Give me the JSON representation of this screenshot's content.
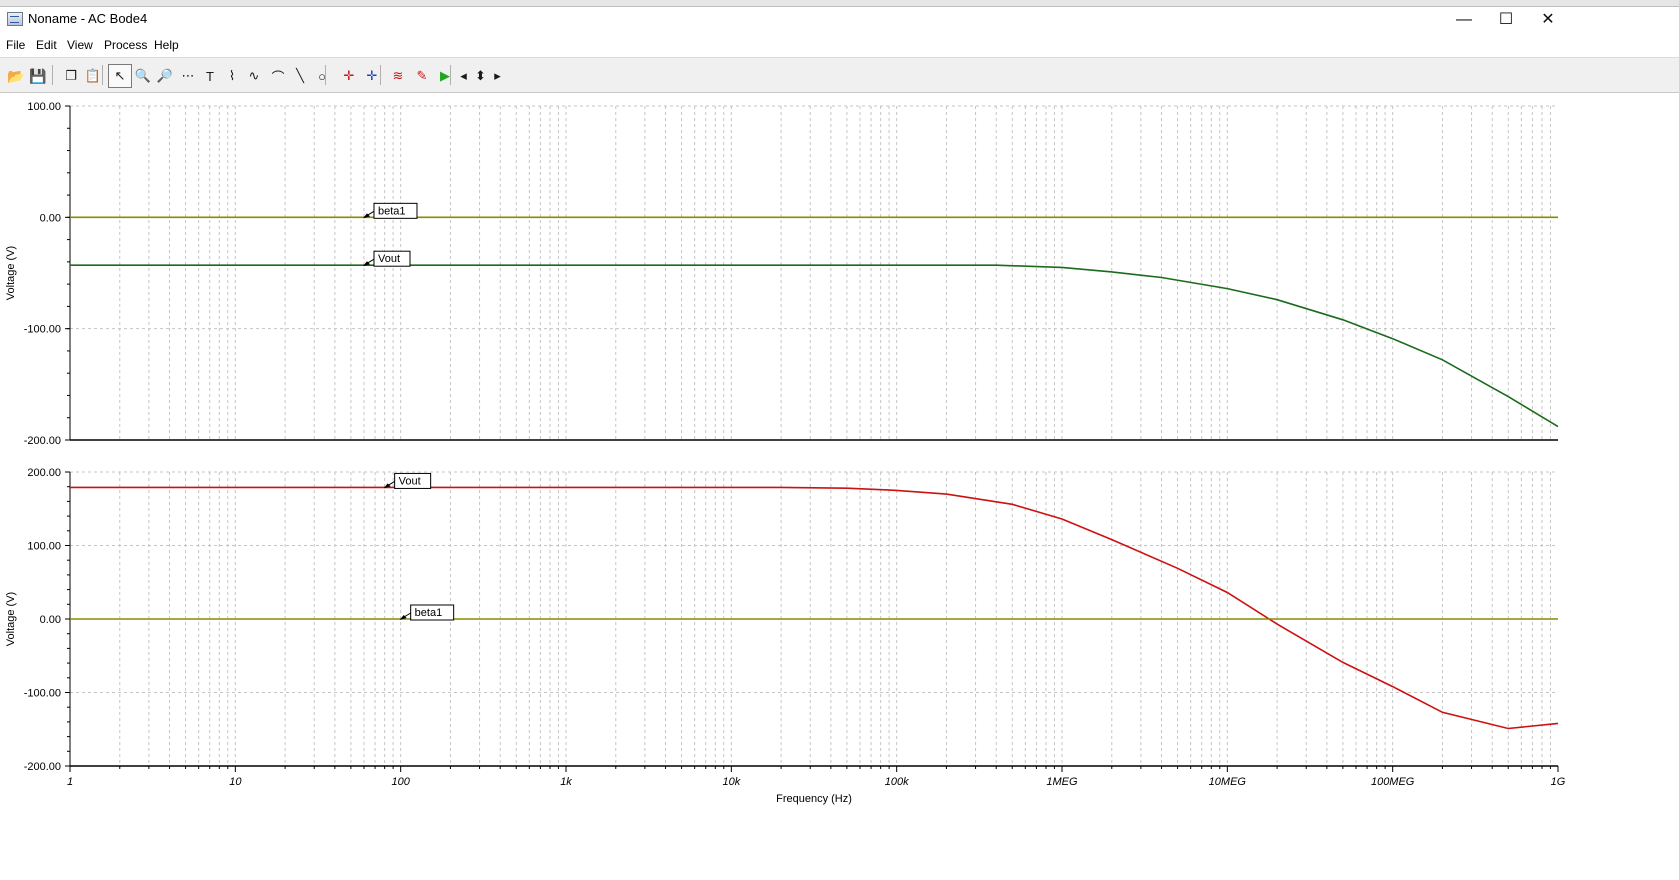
{
  "window": {
    "title": "Noname - AC Bode4",
    "minimize_glyph": "—",
    "maximize_glyph": "☐",
    "close_glyph": "✕"
  },
  "menu": [
    "File",
    "Edit",
    "View",
    "Process",
    "Help"
  ],
  "toolbar": [
    {
      "name": "open-file-button",
      "icon": "folder-open-icon",
      "glyph": "📂"
    },
    {
      "name": "save-button",
      "icon": "save-icon",
      "glyph": "💾"
    },
    {
      "name": "copy-button",
      "icon": "copy-icon",
      "glyph": "❐"
    },
    {
      "name": "paste-button",
      "icon": "paste-icon",
      "glyph": "📋"
    },
    {
      "name": "select-button",
      "icon": "cursor-arrow-icon",
      "glyph": "↖"
    },
    {
      "name": "zoom-in-button",
      "icon": "zoom-in-icon",
      "glyph": "🔍"
    },
    {
      "name": "zoom-out-button",
      "icon": "zoom-out-icon",
      "glyph": "🔎"
    },
    {
      "name": "grid-button",
      "icon": "grid-icon",
      "glyph": "⋯"
    },
    {
      "name": "text-button",
      "icon": "text-icon",
      "glyph": "T"
    },
    {
      "name": "label-button",
      "icon": "label-icon",
      "glyph": "⌇"
    },
    {
      "name": "curve-label-button",
      "icon": "curve-label-icon",
      "glyph": "∿"
    },
    {
      "name": "tangent-button",
      "icon": "tangent-icon",
      "glyph": "⌒"
    },
    {
      "name": "line-button",
      "icon": "line-icon",
      "glyph": "╲"
    },
    {
      "name": "circle-button",
      "icon": "circle-icon",
      "glyph": "○"
    },
    {
      "name": "cursor-a-button",
      "icon": "cursor-a-icon",
      "glyph": "✛"
    },
    {
      "name": "cursor-b-button",
      "icon": "cursor-b-icon",
      "glyph": "✛"
    },
    {
      "name": "add-curve-button",
      "icon": "add-curve-icon",
      "glyph": "≋"
    },
    {
      "name": "probe-button",
      "icon": "probe-icon",
      "glyph": "✎"
    },
    {
      "name": "run-button",
      "icon": "play-icon",
      "glyph": "▶"
    },
    {
      "name": "scroll-left-button",
      "icon": "arrow-left-icon",
      "glyph": "◂"
    },
    {
      "name": "scroll-updown-button",
      "icon": "arrow-updown-icon",
      "glyph": "⬍"
    },
    {
      "name": "scroll-right-button",
      "icon": "arrow-right-icon",
      "glyph": "▸"
    }
  ],
  "chart_data": [
    {
      "type": "line",
      "ylabel": "Voltage (V)",
      "yticks": [
        "100.00",
        "0.00",
        "-100.00",
        "-200.00"
      ],
      "ylim": [
        -200,
        100
      ],
      "xscale": "log",
      "xlim": [
        1,
        1000000000
      ],
      "grid": true,
      "series": [
        {
          "name": "beta1",
          "color": "#8b8b00",
          "x": [
            1,
            1000000000
          ],
          "y": [
            0,
            0
          ],
          "label_at_x": 60
        },
        {
          "name": "Vout",
          "color": "#1b6b1b",
          "x": [
            1,
            100000,
            400000,
            1000000,
            2000000,
            4000000,
            10000000,
            20000000,
            50000000,
            100000000,
            200000000,
            500000000,
            1000000000
          ],
          "y": [
            -43,
            -43,
            -43,
            -45,
            -49,
            -54,
            -64,
            -74,
            -92,
            -109,
            -128,
            -161,
            -188
          ],
          "label_at_x": 60
        }
      ]
    },
    {
      "type": "line",
      "xlabel": "Frequency (Hz)",
      "ylabel": "Voltage (V)",
      "yticks": [
        "200.00",
        "100.00",
        "0.00",
        "-100.00",
        "-200.00"
      ],
      "ylim": [
        -200,
        200
      ],
      "xscale": "log",
      "xticks": [
        "1",
        "10",
        "100",
        "1k",
        "10k",
        "100k",
        "1MEG",
        "10MEG",
        "100MEG",
        "1G"
      ],
      "xlim": [
        1,
        1000000000
      ],
      "grid": true,
      "series": [
        {
          "name": "Vout",
          "color": "#cc1111",
          "x": [
            1,
            10000,
            20000,
            50000,
            100000,
            200000,
            500000,
            1000000,
            2000000,
            5000000,
            10000000,
            20000000,
            50000000,
            100000000,
            200000000,
            500000000,
            1000000000
          ],
          "y": [
            179,
            179,
            179,
            178,
            175,
            170,
            156,
            136,
            108,
            69,
            36,
            -7,
            -59,
            -92,
            -127,
            -149,
            -142
          ],
          "label_at_x": 80
        },
        {
          "name": "beta1",
          "color": "#8b8b00",
          "x": [
            1,
            1000000000
          ],
          "y": [
            0,
            0
          ],
          "label_at_x": 100
        }
      ]
    }
  ]
}
